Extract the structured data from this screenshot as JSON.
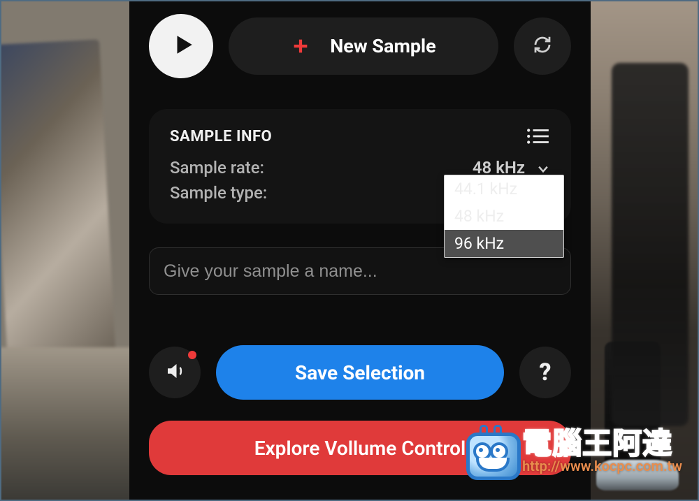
{
  "top": {
    "new_sample_label": "New Sample"
  },
  "sample_info": {
    "title": "SAMPLE INFO",
    "rate_label": "Sample rate:",
    "type_label": "Sample type:",
    "rate_value": "48 kHz",
    "options": [
      "44.1 kHz",
      "48 kHz",
      "96 kHz"
    ]
  },
  "name_input": {
    "placeholder": "Give your sample a name..."
  },
  "actions": {
    "save_label": "Save Selection",
    "explore_label": "Explore Vollume Control"
  },
  "watermark": {
    "text": "電腦王阿達",
    "url": "http://www.kocpc.com.tw"
  }
}
